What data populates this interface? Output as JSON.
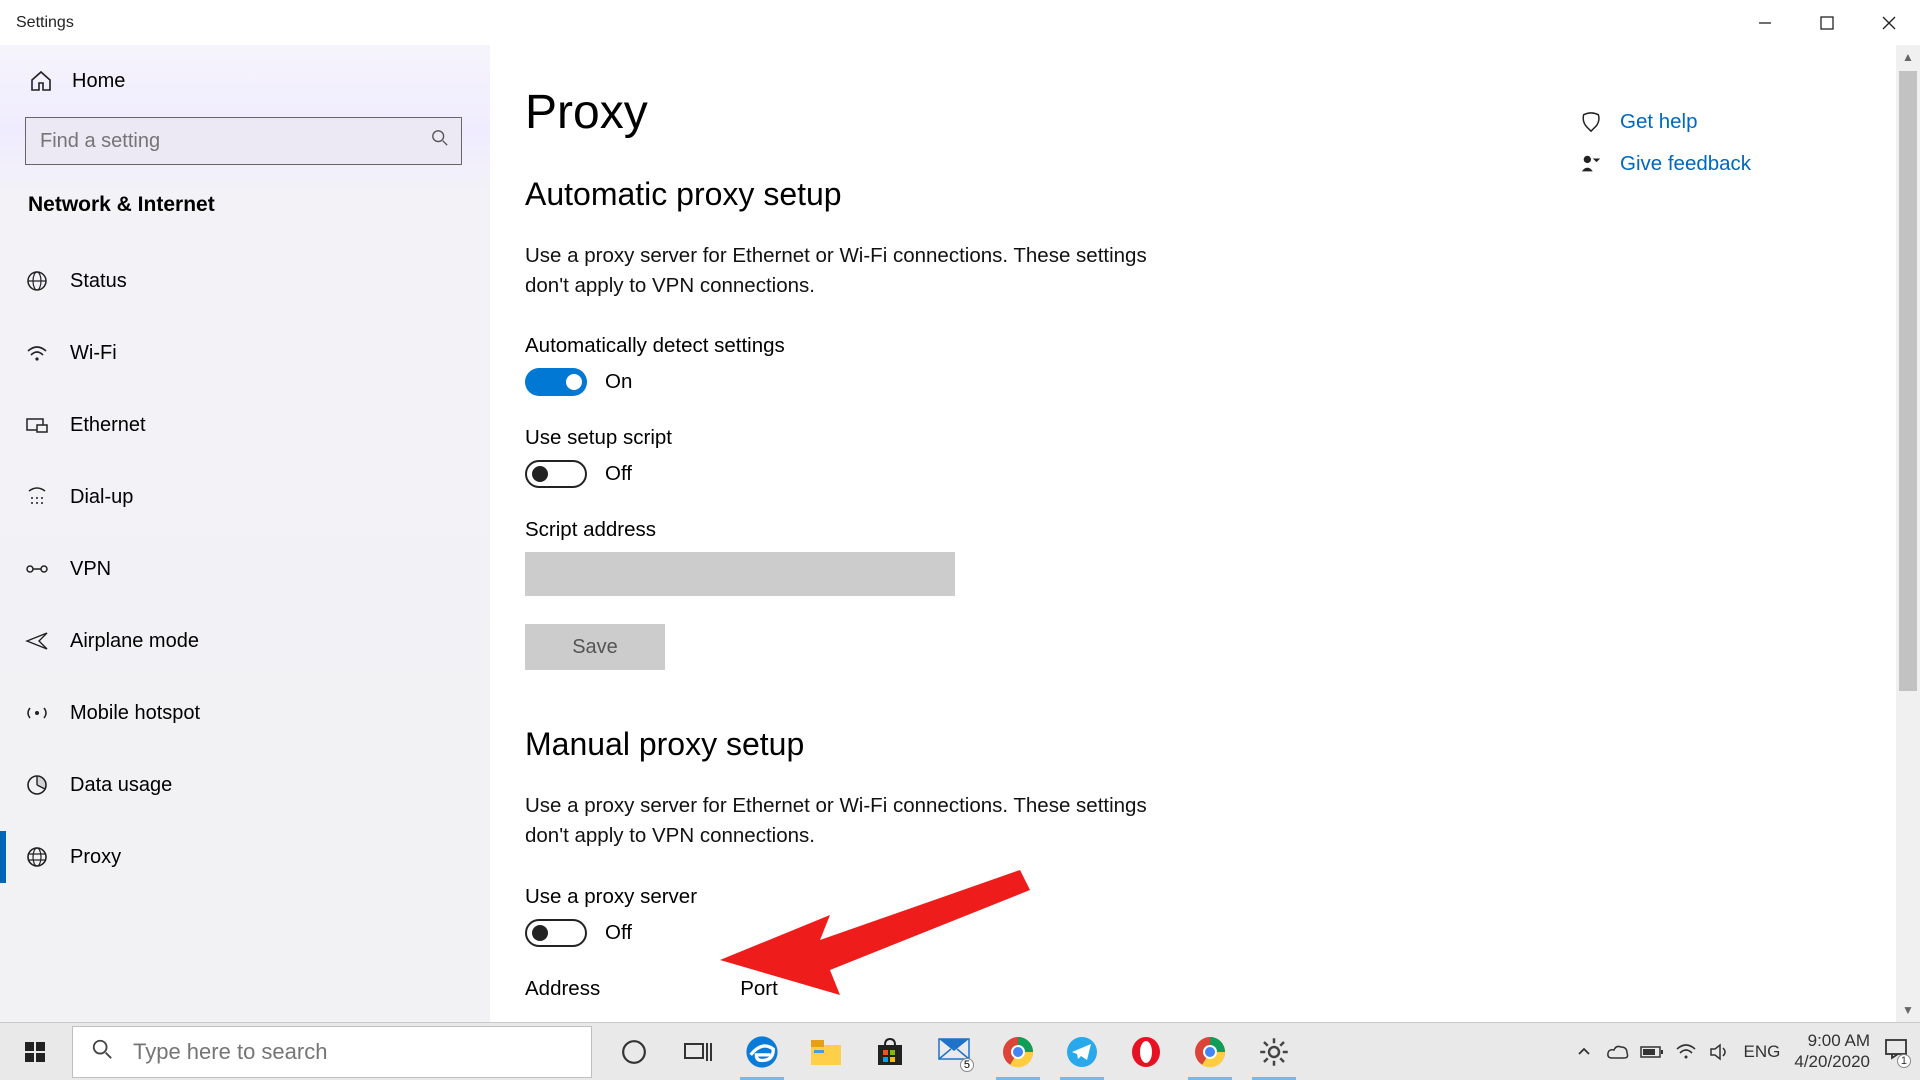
{
  "window": {
    "title": "Settings"
  },
  "sidebar": {
    "home": "Home",
    "search_placeholder": "Find a setting",
    "section": "Network & Internet",
    "items": [
      {
        "label": "Status",
        "icon": "status-icon"
      },
      {
        "label": "Wi-Fi",
        "icon": "wifi-icon"
      },
      {
        "label": "Ethernet",
        "icon": "ethernet-icon"
      },
      {
        "label": "Dial-up",
        "icon": "dialup-icon"
      },
      {
        "label": "VPN",
        "icon": "vpn-icon"
      },
      {
        "label": "Airplane mode",
        "icon": "airplane-icon"
      },
      {
        "label": "Mobile hotspot",
        "icon": "hotspot-icon"
      },
      {
        "label": "Data usage",
        "icon": "data-usage-icon"
      },
      {
        "label": "Proxy",
        "icon": "proxy-icon"
      }
    ]
  },
  "page": {
    "title": "Proxy",
    "auto": {
      "heading": "Automatic proxy setup",
      "desc": "Use a proxy server for Ethernet or Wi-Fi connections. These settings don't apply to VPN connections.",
      "detect_label": "Automatically detect settings",
      "detect_state": "On",
      "script_label": "Use setup script",
      "script_state": "Off",
      "script_addr_label": "Script address",
      "script_addr_value": "",
      "save_label": "Save"
    },
    "manual": {
      "heading": "Manual proxy setup",
      "desc": "Use a proxy server for Ethernet or Wi-Fi connections. These settings don't apply to VPN connections.",
      "use_label": "Use a proxy server",
      "use_state": "Off",
      "address_label": "Address",
      "port_label": "Port"
    }
  },
  "rightlinks": {
    "help": "Get help",
    "feedback": "Give feedback"
  },
  "taskbar": {
    "search_placeholder": "Type here to search",
    "lang": "ENG",
    "time": "9:00 AM",
    "date": "4/20/2020",
    "mail_badge": "5",
    "notif_badge": "1"
  }
}
